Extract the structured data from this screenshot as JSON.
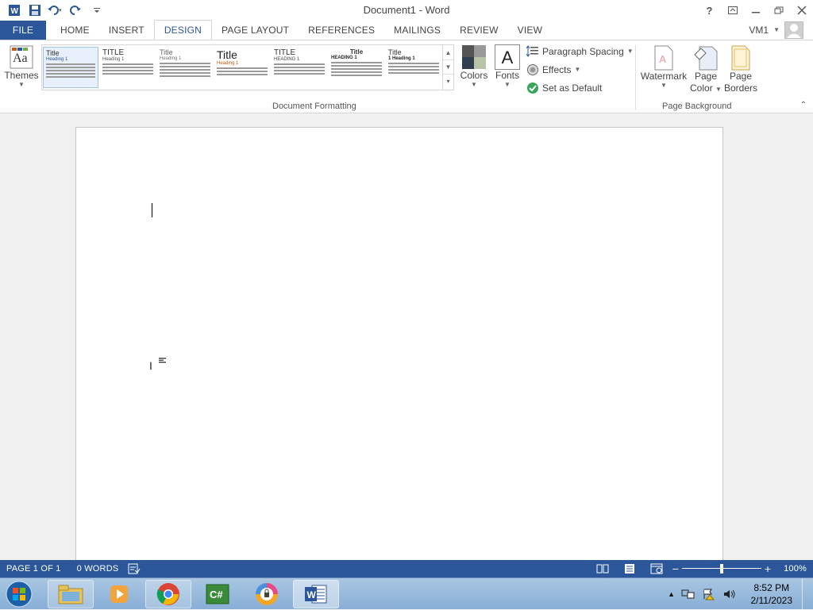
{
  "window": {
    "title": "Document1 - Word"
  },
  "qat": {
    "icons": [
      "word-logo-icon",
      "save-icon",
      "undo-icon",
      "redo-icon",
      "customize-qat-icon"
    ]
  },
  "window_controls": {
    "help": "?",
    "options": "ribbon-display-options-icon",
    "minimize": "minimize-icon",
    "restore": "restore-icon",
    "close": "close-icon"
  },
  "tabs": [
    "FILE",
    "HOME",
    "INSERT",
    "DESIGN",
    "PAGE LAYOUT",
    "REFERENCES",
    "MAILINGS",
    "REVIEW",
    "VIEW"
  ],
  "active_tab": "DESIGN",
  "account": {
    "name": "VM1"
  },
  "ribbon": {
    "themes_label": "Themes",
    "gallery": [
      {
        "title": "Title",
        "heading": "Heading 1"
      },
      {
        "title": "TITLE",
        "heading": "Heading 1"
      },
      {
        "title": "Title",
        "heading": "Heading 1"
      },
      {
        "title": "Title",
        "heading": "Heading 1"
      },
      {
        "title": "TITLE",
        "heading": "HEADING 1"
      },
      {
        "title": "Title",
        "heading": "HEADING 1"
      },
      {
        "title": "Title",
        "heading": "1 Heading 1"
      }
    ],
    "colors_label": "Colors",
    "fonts_label": "Fonts",
    "fonts_glyph": "A",
    "paragraph_spacing": "Paragraph Spacing",
    "effects": "Effects",
    "set_as_default": "Set as Default",
    "group_document_formatting": "Document Formatting",
    "watermark": "Watermark",
    "page_color_1": "Page",
    "page_color_2": "Color",
    "page_borders_1": "Page",
    "page_borders_2": "Borders",
    "group_page_background": "Page Background"
  },
  "status": {
    "page": "PAGE 1 OF 1",
    "words": "0 WORDS",
    "zoom": "100%",
    "zoom_level": 1.0
  },
  "taskbar": {
    "apps": [
      "file-explorer-icon",
      "media-player-icon",
      "chrome-icon",
      "csharp-ide-icon",
      "vpn-shield-icon",
      "word-app-icon"
    ],
    "active_app": "word-app-icon",
    "time": "8:52 PM",
    "date": "2/11/2023"
  },
  "colors": {
    "accent": "#2b579a",
    "status_bar": "#2b579a"
  }
}
